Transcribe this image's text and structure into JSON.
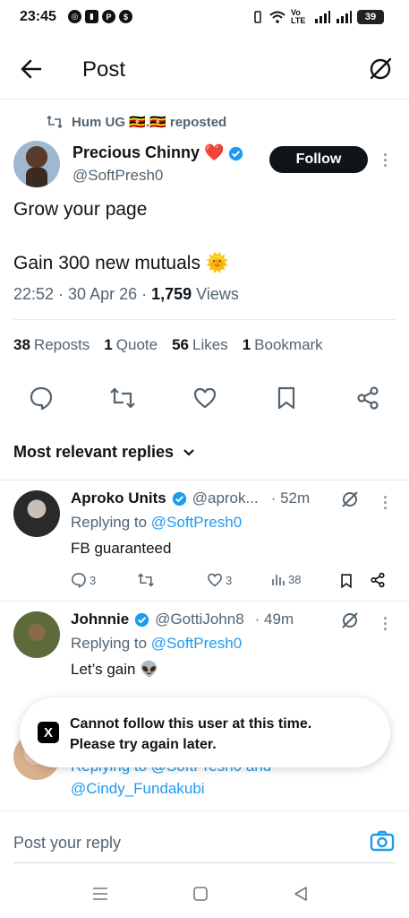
{
  "status_bar": {
    "time": "23:45",
    "left_icons": [
      "whatsapp-icon",
      "app-icon",
      "p-icon",
      "dollar-icon"
    ],
    "network": "Vo LTE",
    "battery": "39"
  },
  "header": {
    "title": "Post",
    "back_icon": "back-arrow-icon",
    "grok_icon": "grok-icon"
  },
  "post": {
    "repost_label": "Hum UG 🇺🇬.🇺🇬 reposted",
    "author_name": "Precious Chinny ❤️",
    "author_handle": "@SoftPresh0",
    "follow_label": "Follow",
    "line1": "Grow your page",
    "line2": "Gain 300 new mutuals 🌞",
    "time": "22:52 · 30 Apr 26 · ",
    "views_count": "1,759",
    "views_label": " Views",
    "stats": {
      "reposts_count": "38",
      "reposts_label": "Reposts",
      "quotes_count": "1",
      "quotes_label": "Quote",
      "likes_count": "56",
      "likes_label": "Likes",
      "bookmarks_count": "1",
      "bookmarks_label": "Bookmark"
    }
  },
  "sort": {
    "label": "Most relevant replies"
  },
  "replies": [
    {
      "name": "Aproko Units",
      "handle": "@aprok...",
      "time": "· 52m",
      "replying_prefix": "Replying to ",
      "replying_to": "@SoftPresh0",
      "text": "FB guaranteed",
      "replies": "3",
      "likes": "3",
      "views": "38"
    },
    {
      "name": "Johnnie",
      "handle": "@GottiJohn8",
      "time": "· 49m",
      "replying_prefix": "Replying to ",
      "replying_to": "@SoftPresh0",
      "text": "Let’s gain 👽"
    },
    {
      "replying_partial": "Replying to @SoftPresh0 and",
      "mention": "@Cindy_Fundakubi"
    }
  ],
  "toast": {
    "line1": "Cannot follow this user at this time.",
    "line2": "Please try again later.",
    "logo": "X"
  },
  "compose": {
    "placeholder": "Post your reply"
  },
  "colors": {
    "accent": "#1d9bf0",
    "text": "#0f1419",
    "muted": "#536471",
    "like_heart": "#e0245e"
  }
}
